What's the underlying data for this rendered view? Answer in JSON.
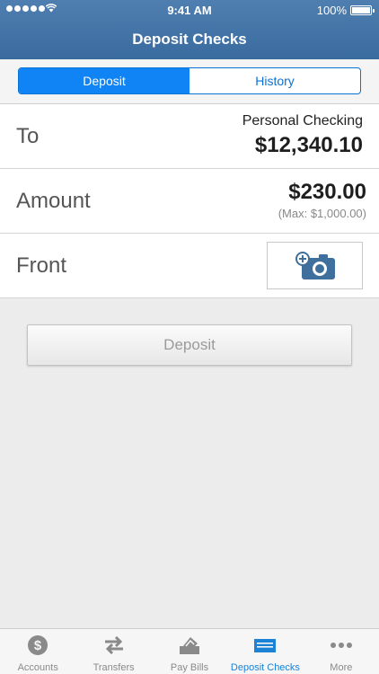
{
  "status_bar": {
    "time": "9:41 AM",
    "battery": "100%"
  },
  "header": {
    "title": "Deposit Checks"
  },
  "segments": {
    "deposit": "Deposit",
    "history": "History"
  },
  "to_row": {
    "label": "To",
    "account": "Personal Checking",
    "balance": "$12,340.10"
  },
  "amount_row": {
    "label": "Amount",
    "amount": "$230.00",
    "max_note": "(Max: $1,000.00)"
  },
  "front_row": {
    "label": "Front",
    "icon": "add-camera-icon"
  },
  "deposit_button": {
    "label": "Deposit"
  },
  "tabs": [
    {
      "label": "Accounts",
      "icon": "dollar-coin-icon"
    },
    {
      "label": "Transfers",
      "icon": "arrows-icon"
    },
    {
      "label": "Pay Bills",
      "icon": "pay-bills-icon"
    },
    {
      "label": "Deposit Checks",
      "icon": "check-icon",
      "active": true
    },
    {
      "label": "More",
      "icon": "more-dots-icon"
    }
  ],
  "colors": {
    "header": "#3a6b9f",
    "accent": "#1083f5",
    "tab_active": "#1b82d6",
    "camera": "#3f6f9c"
  }
}
